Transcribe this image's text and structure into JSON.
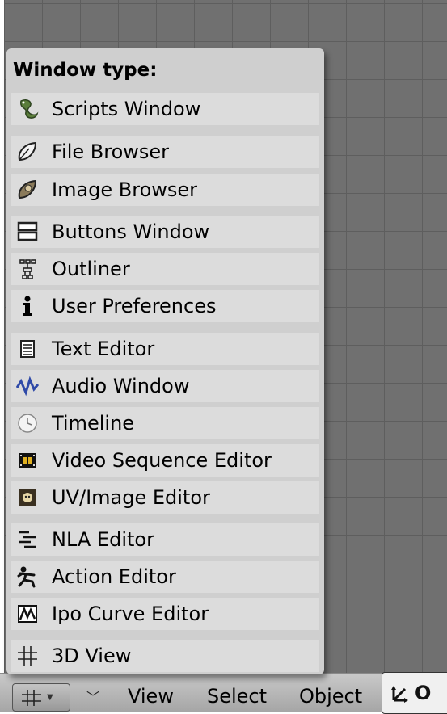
{
  "menu": {
    "title": "Window type:",
    "items": [
      {
        "label": "Scripts Window",
        "icon": "python-snake-icon"
      },
      {
        "label": "File Browser",
        "icon": "folder-leaf-icon"
      },
      {
        "label": "Image Browser",
        "icon": "image-browser-icon"
      },
      {
        "label": "Buttons Window",
        "icon": "buttons-window-icon"
      },
      {
        "label": "Outliner",
        "icon": "outliner-icon"
      },
      {
        "label": "User Preferences",
        "icon": "info-icon"
      },
      {
        "label": "Text Editor",
        "icon": "text-editor-icon"
      },
      {
        "label": "Audio Window",
        "icon": "audio-wave-icon"
      },
      {
        "label": "Timeline",
        "icon": "clock-icon"
      },
      {
        "label": "Video Sequence Editor",
        "icon": "film-strip-icon"
      },
      {
        "label": "UV/Image Editor",
        "icon": "uv-image-icon"
      },
      {
        "label": "NLA Editor",
        "icon": "nla-icon"
      },
      {
        "label": "Action Editor",
        "icon": "action-figure-icon"
      },
      {
        "label": "Ipo Curve Editor",
        "icon": "ipo-curve-icon"
      },
      {
        "label": "3D View",
        "icon": "grid-3d-icon"
      }
    ]
  },
  "header": {
    "menus": [
      "View",
      "Select",
      "Object"
    ],
    "mode_label": "O"
  }
}
